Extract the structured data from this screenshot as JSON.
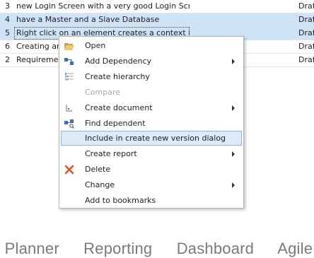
{
  "grid": {
    "rows": [
      {
        "id": "3",
        "title": "new Login Screen with a very good Login Screen",
        "status": "Draft"
      },
      {
        "id": "4",
        "title": "have a Master and a Slave Database",
        "status": "Draft"
      },
      {
        "id": "5",
        "title": "Right click on an element creates a context menu",
        "status": "Draft"
      },
      {
        "id": "6",
        "title": "Creating an",
        "status": "Draft"
      },
      {
        "id": "2",
        "title": "Requirement",
        "status": "Draft"
      }
    ]
  },
  "context_menu": {
    "items": [
      {
        "label": "Open",
        "icon": "folder-open-icon"
      },
      {
        "label": "Add Dependency",
        "icon": "add-dependency-icon",
        "submenu": true
      },
      {
        "label": "Create hierarchy",
        "icon": "hierarchy-icon"
      },
      {
        "label": "Compare",
        "disabled": true
      },
      {
        "label": "Create document",
        "icon": "document-icon",
        "submenu": true
      },
      {
        "label": "Find dependent",
        "icon": "find-dependent-icon"
      },
      {
        "label": "Include in create new version dialog",
        "highlighted": true
      },
      {
        "label": "Create report",
        "submenu": true
      },
      {
        "label": "Delete",
        "icon": "delete-icon",
        "icon_color": "#e8502e"
      },
      {
        "label": "Change",
        "submenu": true
      },
      {
        "label": "Add to bookmarks"
      }
    ]
  },
  "bottom_tabs": [
    "t Planner",
    "Reporting",
    "Dashboard",
    "Agile"
  ],
  "colors": {
    "selection": "#cfe3f7",
    "menu_highlight": "#ddeaf8",
    "delete_icon": "#e8502e"
  }
}
